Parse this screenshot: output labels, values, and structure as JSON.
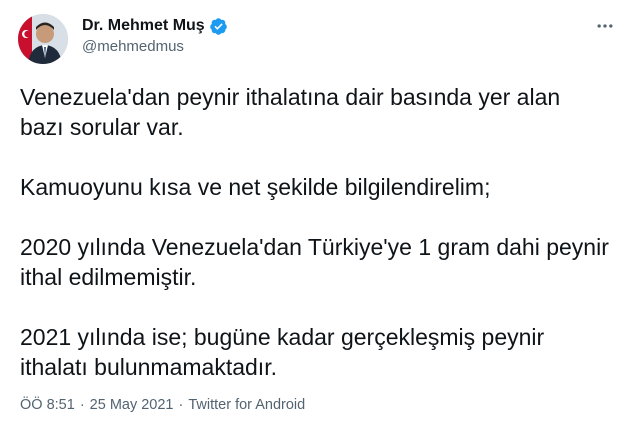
{
  "author": {
    "display_name": "Dr. Mehmet Muş",
    "handle": "@mehmedmus",
    "verified": true,
    "verified_color": "#1d9bf0"
  },
  "tweet": {
    "paragraphs": [
      "Venezuela'dan peynir ithalatına dair basında yer alan bazı sorular var.",
      "Kamuoyunu kısa ve net şekilde bilgilendirelim;",
      "2020 yılında Venezuela'dan Türkiye'ye 1 gram dahi peynir ithal edilmemiştir.",
      "2021 yılında ise; bugüne kadar gerçekleşmiş peynir ithalatı bulunmamaktadır."
    ],
    "time": "ÖÖ 8:51",
    "date": "25 May 2021",
    "source": "Twitter for Android",
    "separator": "·"
  },
  "icons": {
    "more": "more-options-icon",
    "verified": "verified-badge-icon"
  }
}
